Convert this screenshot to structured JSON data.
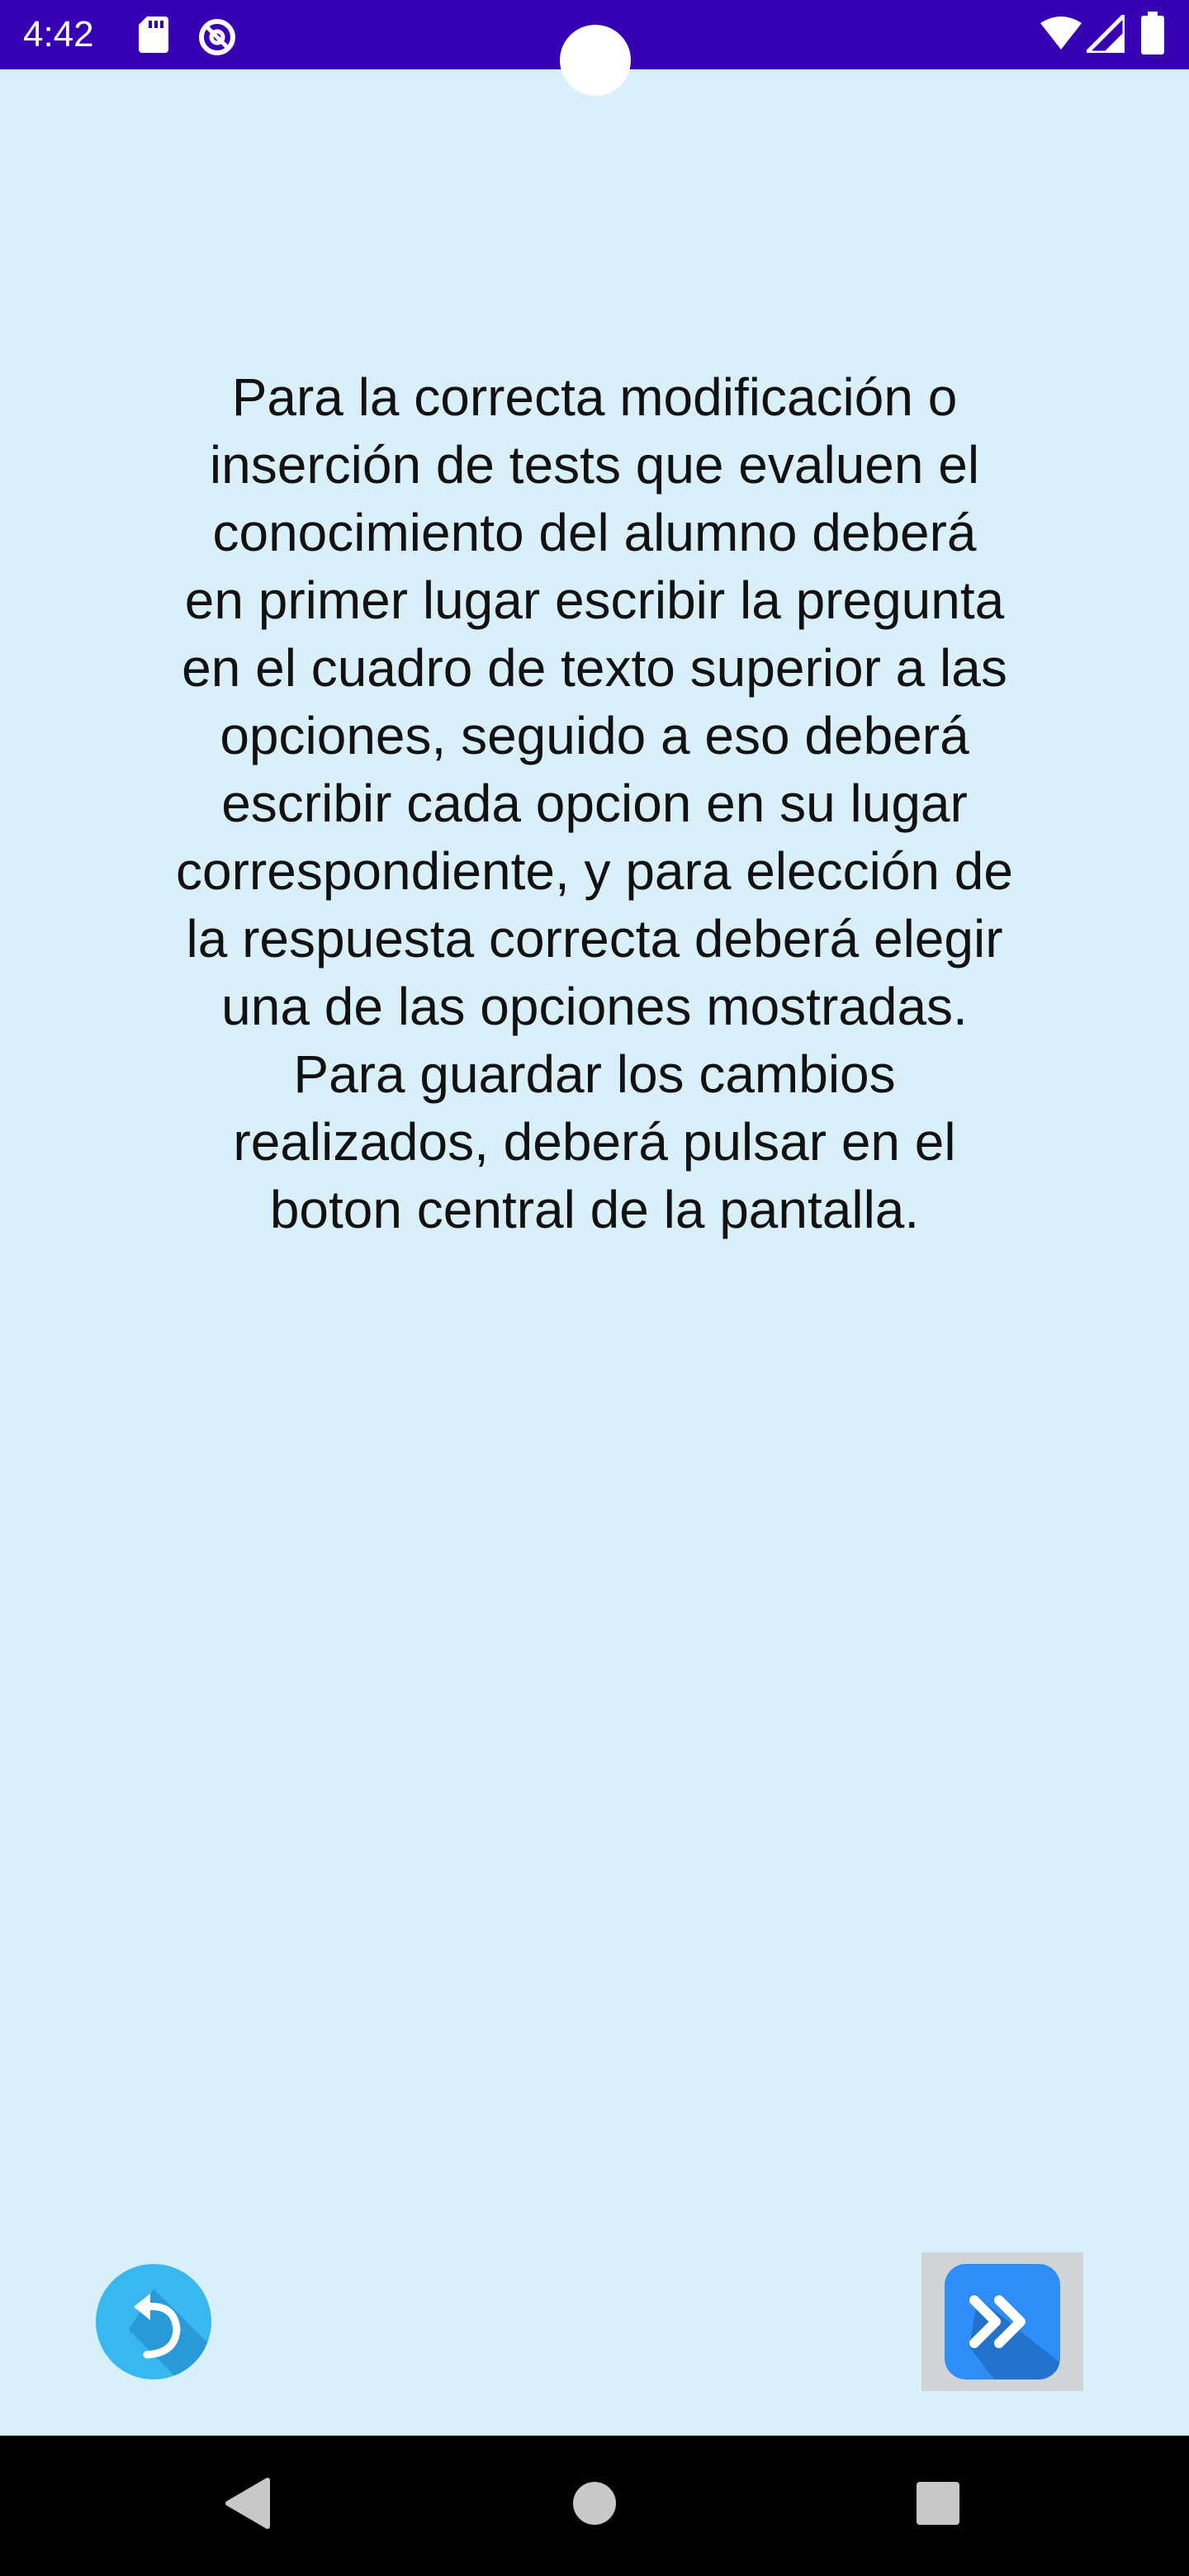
{
  "status_bar": {
    "time": "4:42",
    "icons": [
      "sd-card-icon",
      "sync-icon",
      "wifi-icon",
      "signal-icon",
      "battery-icon"
    ],
    "background_color": "#3700b3"
  },
  "main": {
    "background_color": "#d9f0fa",
    "instructions": "Para la correcta modificación o\ninserción de tests que evaluen el\nconocimiento del alumno deberá\nen primer lugar escribir la pregunta\nen el cuadro de texto superior a las\nopciones, seguido a eso deberá\nescribir cada opcion en su lugar\ncorrespondiente, y para elección de\nla respuesta correcta deberá elegir\nuna de las opciones mostradas.\nPara guardar los cambios\nrealizados, deberá pulsar en el\nboton central de la pantalla."
  },
  "buttons": {
    "back": {
      "icon": "undo-arrow-icon",
      "color": "#39b8f0"
    },
    "next": {
      "icon": "double-chevron-right-icon",
      "color": "#2f8ef5"
    }
  },
  "navigation_bar": {
    "icons": [
      "nav-back-icon",
      "nav-home-icon",
      "nav-recents-icon"
    ]
  }
}
